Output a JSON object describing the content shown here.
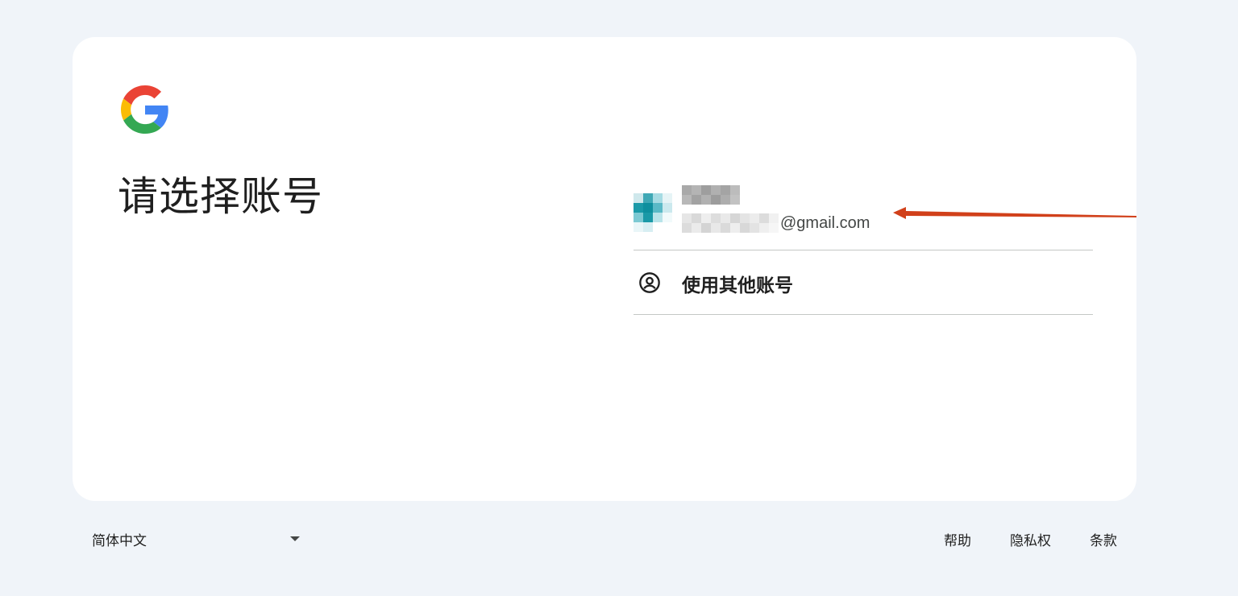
{
  "logo": {
    "icon": "google-g-logo-icon",
    "colors": [
      "#ea4335",
      "#fbbc05",
      "#34a853",
      "#4285f4"
    ]
  },
  "page": {
    "title": "请选择账号"
  },
  "account": {
    "avatar_icon": "avatar-pixelated",
    "name_redacted": true,
    "email_domain": "@gmail.com"
  },
  "other_account": {
    "icon": "account-circle-icon",
    "label": "使用其他账号"
  },
  "annotation": {
    "arrow_color": "#d1401a"
  },
  "footer": {
    "language": "简体中文",
    "links": {
      "help": "帮助",
      "privacy": "隐私权",
      "terms": "条款"
    }
  }
}
